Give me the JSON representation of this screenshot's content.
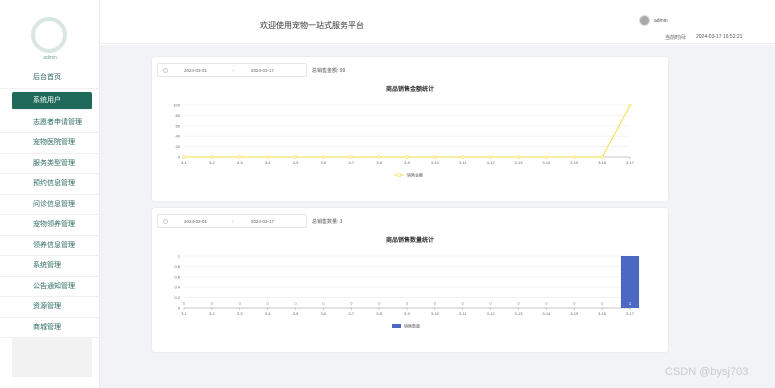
{
  "sidebar": {
    "username": "admin",
    "items": [
      {
        "label": "后台首页",
        "active": false
      },
      {
        "label": "系统用户",
        "active": true
      },
      {
        "label": "志愿者申请管理",
        "active": false
      },
      {
        "label": "宠物医院管理",
        "active": false
      },
      {
        "label": "服务类型管理",
        "active": false
      },
      {
        "label": "预约信息管理",
        "active": false
      },
      {
        "label": "问诊信息管理",
        "active": false
      },
      {
        "label": "宠物领养管理",
        "active": false
      },
      {
        "label": "领养信息管理",
        "active": false
      },
      {
        "label": "系统管理",
        "active": false
      },
      {
        "label": "公告通知管理",
        "active": false
      },
      {
        "label": "资源管理",
        "active": false
      },
      {
        "label": "商城管理",
        "active": false
      }
    ]
  },
  "header": {
    "title": "欢迎使用宠物一站式服务平台",
    "user": "admin",
    "time_label": "当前时间:",
    "time_value": "2024-03-17 16:52:21"
  },
  "panel1": {
    "start_date": "2024-03-01",
    "separator": "-",
    "end_date": "2024-03-17",
    "total_label": "总销售金额:",
    "total_value": "99"
  },
  "panel2": {
    "start_date": "2024-03-01",
    "separator": "-",
    "end_date": "2024-03-17",
    "total_label": "总销售数量:",
    "total_value": "1"
  },
  "chart_data": [
    {
      "type": "line",
      "title": "商品销售金额统计",
      "categories": [
        "3-1",
        "3-2",
        "3-3",
        "3-4",
        "3-5",
        "3-6",
        "3-7",
        "3-8",
        "3-9",
        "3-10",
        "3-11",
        "3-12",
        "3-13",
        "3-14",
        "3-15",
        "3-16",
        "3-17"
      ],
      "series": [
        {
          "name": "销售金额",
          "values": [
            0,
            0,
            0,
            0,
            0,
            0,
            0,
            0,
            0,
            0,
            0,
            0,
            0,
            0,
            0,
            0,
            99
          ]
        }
      ],
      "yticks": [
        0,
        20,
        40,
        60,
        80,
        100
      ],
      "ylim": [
        0,
        100
      ],
      "color": "#f5e04a",
      "grid": true,
      "legend": "bottom"
    },
    {
      "type": "bar",
      "title": "商品销售数量统计",
      "categories": [
        "3-1",
        "3-2",
        "3-3",
        "3-4",
        "3-5",
        "3-6",
        "3-7",
        "3-8",
        "3-9",
        "3-10",
        "3-11",
        "3-12",
        "3-13",
        "3-14",
        "3-15",
        "3-16",
        "3-17"
      ],
      "series": [
        {
          "name": "销售数量",
          "values": [
            0,
            0,
            0,
            0,
            0,
            0,
            0,
            0,
            0,
            0,
            0,
            0,
            0,
            0,
            0,
            0,
            1
          ]
        }
      ],
      "yticks": [
        0,
        0.2,
        0.4,
        0.6,
        0.8,
        1
      ],
      "ylim": [
        0,
        1
      ],
      "color": "#4b69c3",
      "grid": true,
      "legend": "bottom"
    }
  ],
  "watermark": "CSDN @bysj703"
}
